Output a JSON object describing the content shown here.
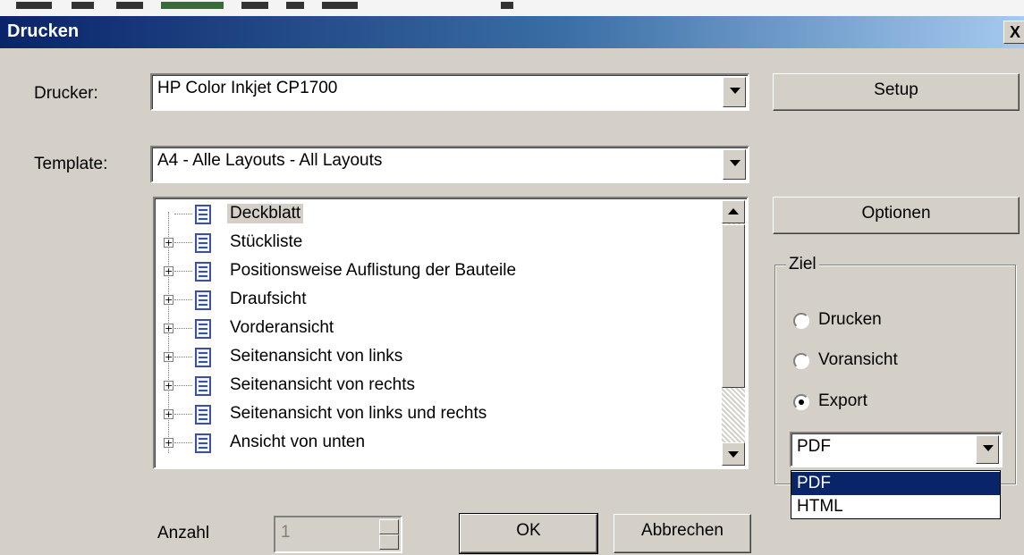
{
  "window": {
    "title": "Drucken",
    "close_label": "X"
  },
  "printer": {
    "label": "Drucker:",
    "value": "HP Color Inkjet CP1700"
  },
  "template": {
    "label": "Template:",
    "value": "A4 - Alle Layouts - All Layouts"
  },
  "buttons": {
    "setup": "Setup",
    "options": "Optionen",
    "ok": "OK",
    "cancel": "Abbrechen"
  },
  "tree": {
    "items": [
      {
        "label": "Deckblatt",
        "expandable": false,
        "selected": true
      },
      {
        "label": "Stückliste",
        "expandable": true
      },
      {
        "label": "Positionsweise Auflistung der Bauteile",
        "expandable": true
      },
      {
        "label": "Draufsicht",
        "expandable": true
      },
      {
        "label": "Vorderansicht",
        "expandable": true
      },
      {
        "label": "Seitenansicht von links",
        "expandable": true
      },
      {
        "label": "Seitenansicht von rechts",
        "expandable": true
      },
      {
        "label": "Seitenansicht von links und rechts",
        "expandable": true
      },
      {
        "label": "Ansicht von unten",
        "expandable": true
      }
    ]
  },
  "target": {
    "legend": "Ziel",
    "options": [
      "Drucken",
      "Voransicht",
      "Export"
    ],
    "selected": "Export",
    "format_value": "PDF",
    "format_options": [
      "PDF",
      "HTML"
    ]
  },
  "count": {
    "label": "Anzahl",
    "value": "1"
  },
  "colors": {
    "title_start": "#0a246a",
    "title_end": "#a6caf0",
    "highlight": "#0a246a",
    "face": "#d4d0c8"
  }
}
